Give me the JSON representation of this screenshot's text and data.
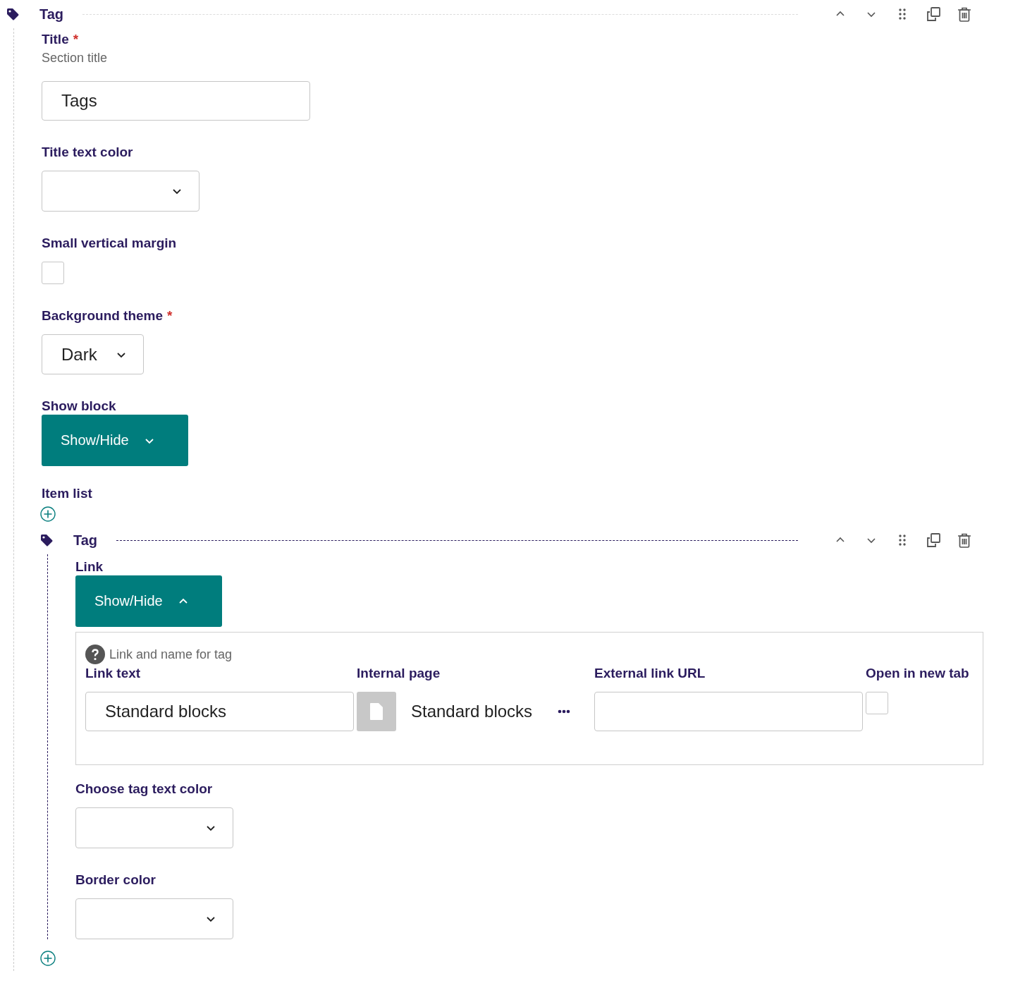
{
  "block": {
    "title": "Tag",
    "fields": [
      {
        "kind": "text",
        "label": "Title",
        "required_mark": "*",
        "help": "Section title",
        "value": "Tags"
      },
      {
        "kind": "select",
        "label": "Title text color"
      },
      {
        "kind": "checkbox",
        "label": "Small vertical margin",
        "checked": false
      },
      {
        "kind": "select",
        "label": "Background theme",
        "required_mark": "*",
        "value": "Dark"
      },
      {
        "kind": "toggle",
        "label": "Show block",
        "button": "Show/Hide",
        "expanded": false
      },
      {
        "kind": "list",
        "label": "Item list",
        "items": [
          {
            "title": "Tag",
            "fields": [
              {
                "kind": "toggle",
                "label": "Link",
                "button": "Show/Hide",
                "expanded": true,
                "panel": {
                  "help": "Link and name for tag",
                  "columns": [
                    {
                      "kind": "text",
                      "label": "Link text",
                      "value": "Standard blocks"
                    },
                    {
                      "kind": "page",
                      "label": "Internal page",
                      "value": "Standard blocks"
                    },
                    {
                      "kind": "text",
                      "label": "External link URL"
                    },
                    {
                      "kind": "checkbox",
                      "label": "Open in new tab",
                      "checked": false
                    }
                  ]
                }
              },
              {
                "kind": "select",
                "label": "Choose tag text color"
              },
              {
                "kind": "select",
                "label": "Border color"
              }
            ]
          }
        ]
      }
    ]
  }
}
